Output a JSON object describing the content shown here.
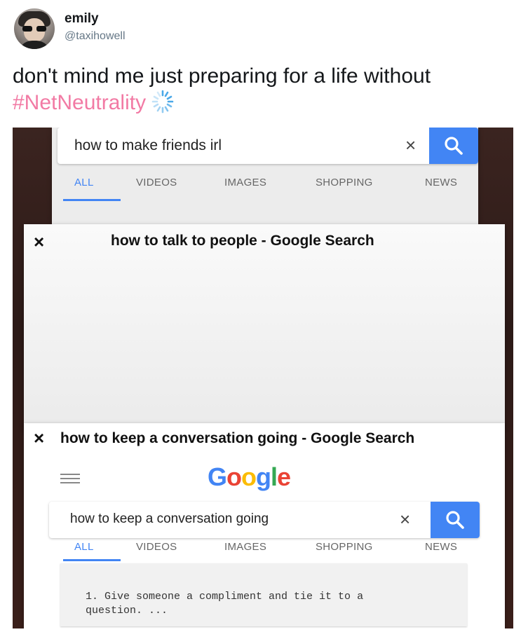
{
  "tweet": {
    "name": "emily",
    "handle": "@taxihowell",
    "text_main": "don't mind me just preparing for a life without ",
    "hashtag": "#NetNeutrality",
    "hashtag_color": "#f27aa4",
    "avatar_icon": "profile-photo"
  },
  "screenshot": {
    "card1": {
      "query": "how to make friends irl",
      "tabs": [
        "ALL",
        "VIDEOS",
        "IMAGES",
        "SHOPPING",
        "NEWS"
      ],
      "active_tab": "ALL"
    },
    "card2": {
      "title": "how to talk to people - Google Search"
    },
    "card3": {
      "title": "how to keep a conversation going - Google Search",
      "logo": "Google",
      "query": "how to keep a conversation going",
      "tabs": [
        "ALL",
        "VIDEOS",
        "IMAGES",
        "SHOPPING",
        "NEWS"
      ],
      "active_tab": "ALL",
      "result": "1. Give someone a compliment and tie it to a question. ..."
    },
    "close_glyph": "×",
    "accent_color": "#4285f4"
  }
}
